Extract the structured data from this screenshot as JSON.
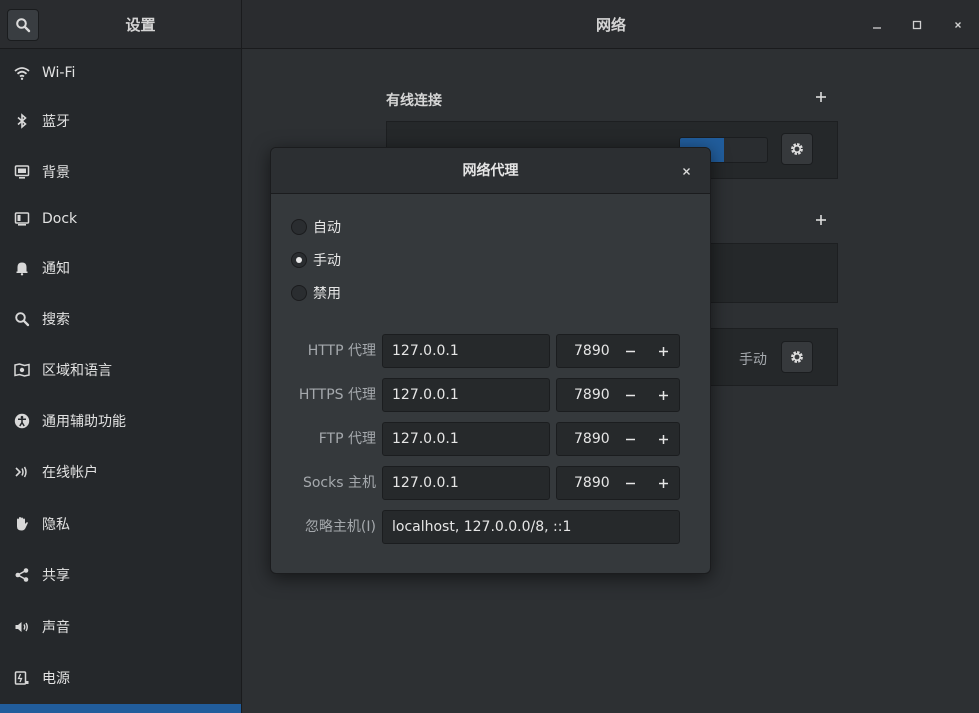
{
  "header": {
    "left_title": "设置",
    "main_title": "网络"
  },
  "sidebar": {
    "items": [
      {
        "label": "Wi-Fi",
        "icon": "wifi-icon"
      },
      {
        "label": "蓝牙",
        "icon": "bluetooth-icon"
      },
      {
        "label": "背景",
        "icon": "background-icon"
      },
      {
        "label": "Dock",
        "icon": "dock-icon"
      },
      {
        "label": "通知",
        "icon": "bell-icon"
      },
      {
        "label": "搜索",
        "icon": "search-icon"
      },
      {
        "label": "区域和语言",
        "icon": "region-icon"
      },
      {
        "label": "通用辅助功能",
        "icon": "accessibility-icon"
      },
      {
        "label": "在线帐户",
        "icon": "online-accounts-icon"
      },
      {
        "label": "隐私",
        "icon": "hand-icon"
      },
      {
        "label": "共享",
        "icon": "share-icon"
      },
      {
        "label": "声音",
        "icon": "speaker-icon"
      },
      {
        "label": "电源",
        "icon": "power-icon"
      }
    ]
  },
  "main": {
    "wired_title": "有线连接",
    "proxy_status": "手动"
  },
  "dialog": {
    "title": "网络代理",
    "modes": [
      {
        "label": "自动",
        "checked": false
      },
      {
        "label": "手动",
        "checked": true
      },
      {
        "label": "禁用",
        "checked": false
      }
    ],
    "proxies": [
      {
        "label": "HTTP 代理",
        "host": "127.0.0.1",
        "port": "7890"
      },
      {
        "label": "HTTPS 代理",
        "host": "127.0.0.1",
        "port": "7890"
      },
      {
        "label": "FTP 代理",
        "host": "127.0.0.1",
        "port": "7890"
      },
      {
        "label": "Socks 主机",
        "host": "127.0.0.1",
        "port": "7890"
      }
    ],
    "ignore_label": "忽略主机(I)",
    "ignore_value": "localhost, 127.0.0.0/8, ::1"
  },
  "colors": {
    "accent": "#215d9c"
  }
}
